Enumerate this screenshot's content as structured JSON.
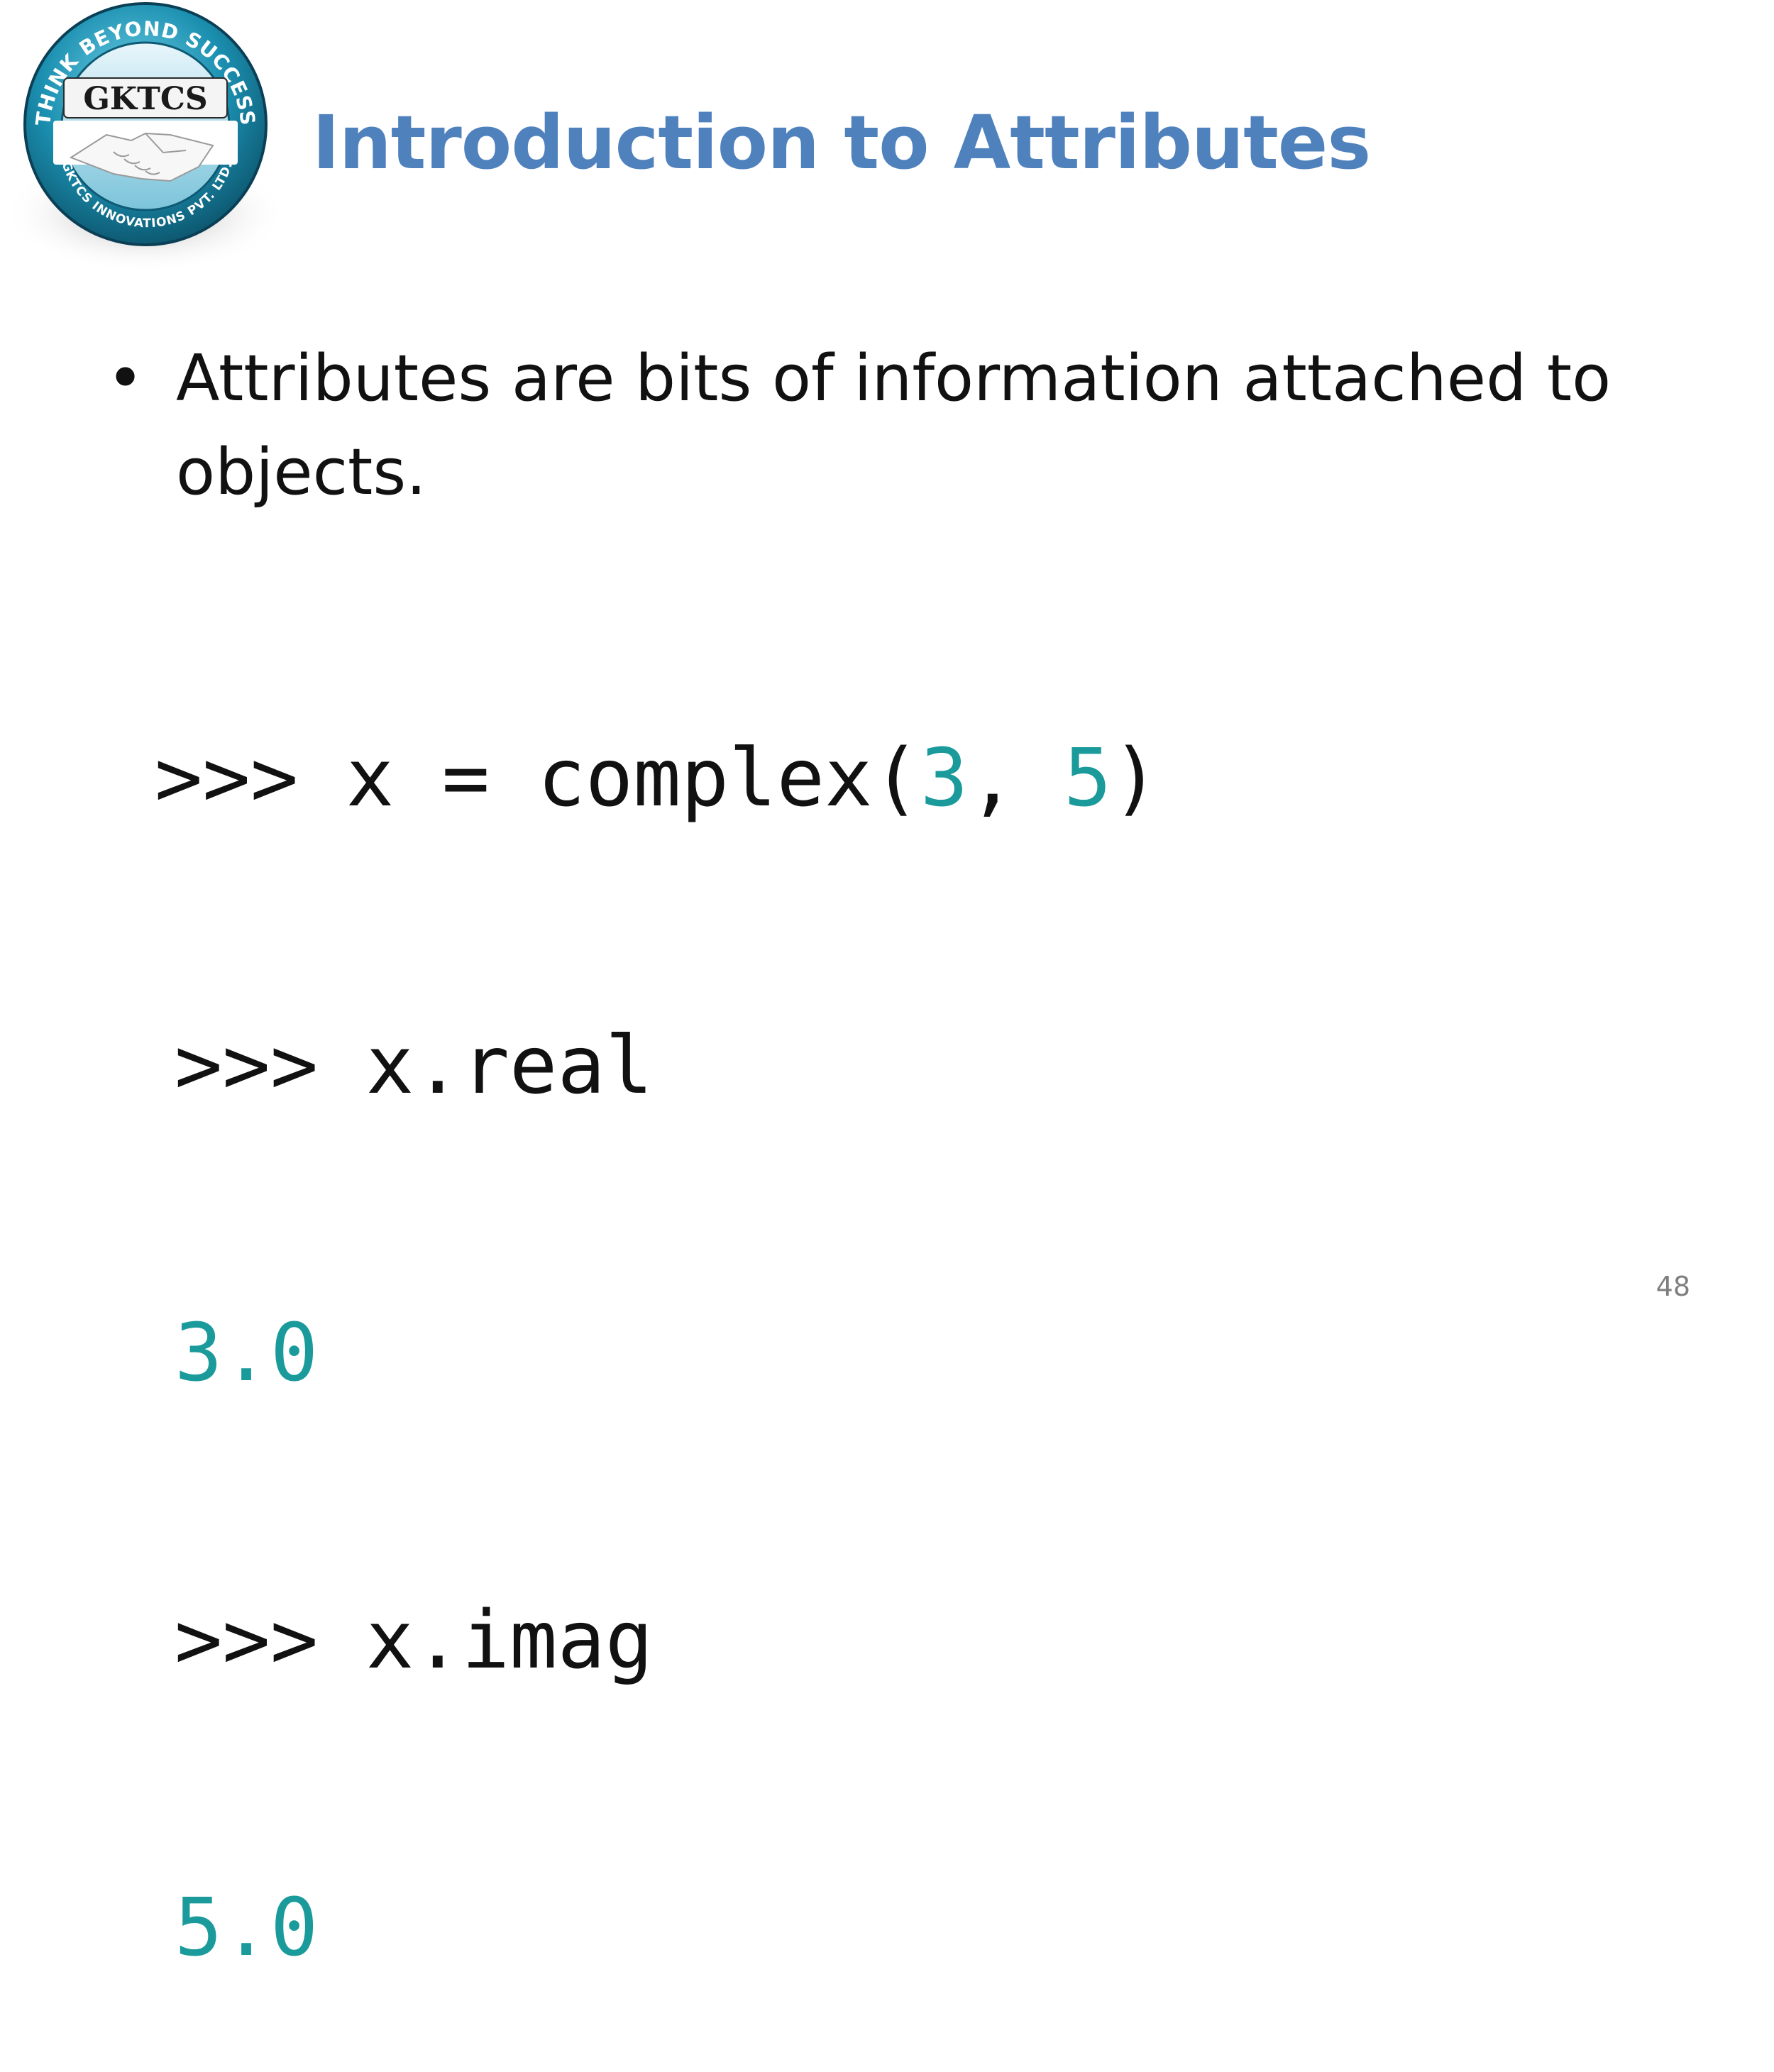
{
  "colors": {
    "title": "#4f81bd",
    "number": "#1a9a9a",
    "text": "#111111",
    "page_number": "#7f7f7f"
  },
  "logo": {
    "brand": "GKTCS",
    "top_arc": "THINK BEYOND SUCCESS",
    "bottom_arc": "GKTCS INNOVATIONS PVT. LTD.",
    "icon": "handshake-icon"
  },
  "slide": {
    "title": "Introduction to Attributes",
    "bullet": "Attributes are bits of information attached to objects.",
    "page_number": "48"
  },
  "code": {
    "line1_prompt": ">>> x = complex(",
    "line1_arg1": "3",
    "line1_sep": ", ",
    "line1_arg2": "5",
    "line1_close": ")",
    "line2": ">>> x.real",
    "line3": "3.0",
    "line4": ">>> x.imag",
    "line5": "5.0"
  }
}
